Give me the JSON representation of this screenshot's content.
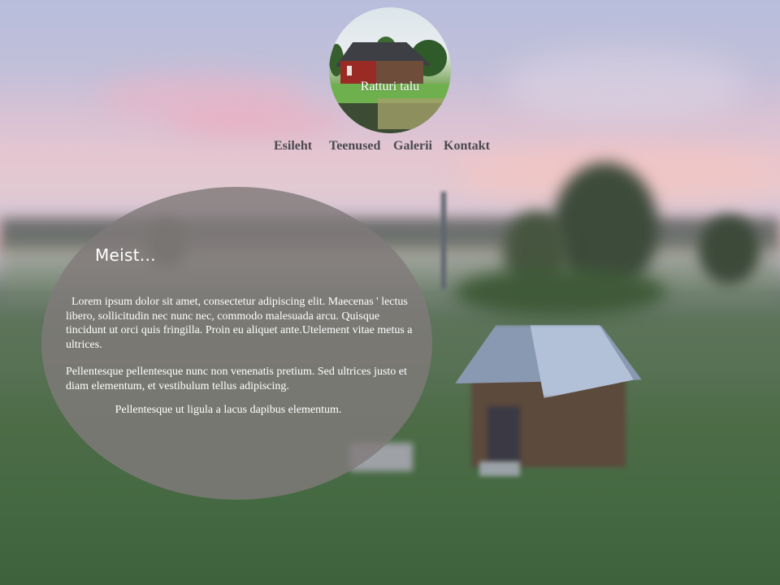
{
  "logo": {
    "text": "Ratturi talu"
  },
  "nav": {
    "items": [
      "Esileht",
      "Teenused",
      "Galerii",
      "Kontakt"
    ]
  },
  "content": {
    "heading": "Meist...",
    "paragraph1": "  Lorem ipsum dolor sit amet, consectetur adipiscing elit. Maecenas ' lectus libero, sollicitudin nec nunc nec, commodo malesuada arcu. Quisque tincidunt ut orci quis fringilla. Proin eu aliquet ante.Utelement vitae metus a ultrices.",
    "paragraph2": "Pellentesque pellentesque nunc non venenatis pretium. Sed ultrices justo et diam elementum, et vestibulum tellus adipiscing.",
    "paragraph3": "Pellentesque ut ligula a lacus dapibus elementum."
  },
  "colors": {
    "nav_text": "#4a4a4f",
    "oval_fill": "#807a7a",
    "body_text": "#ffffff"
  }
}
